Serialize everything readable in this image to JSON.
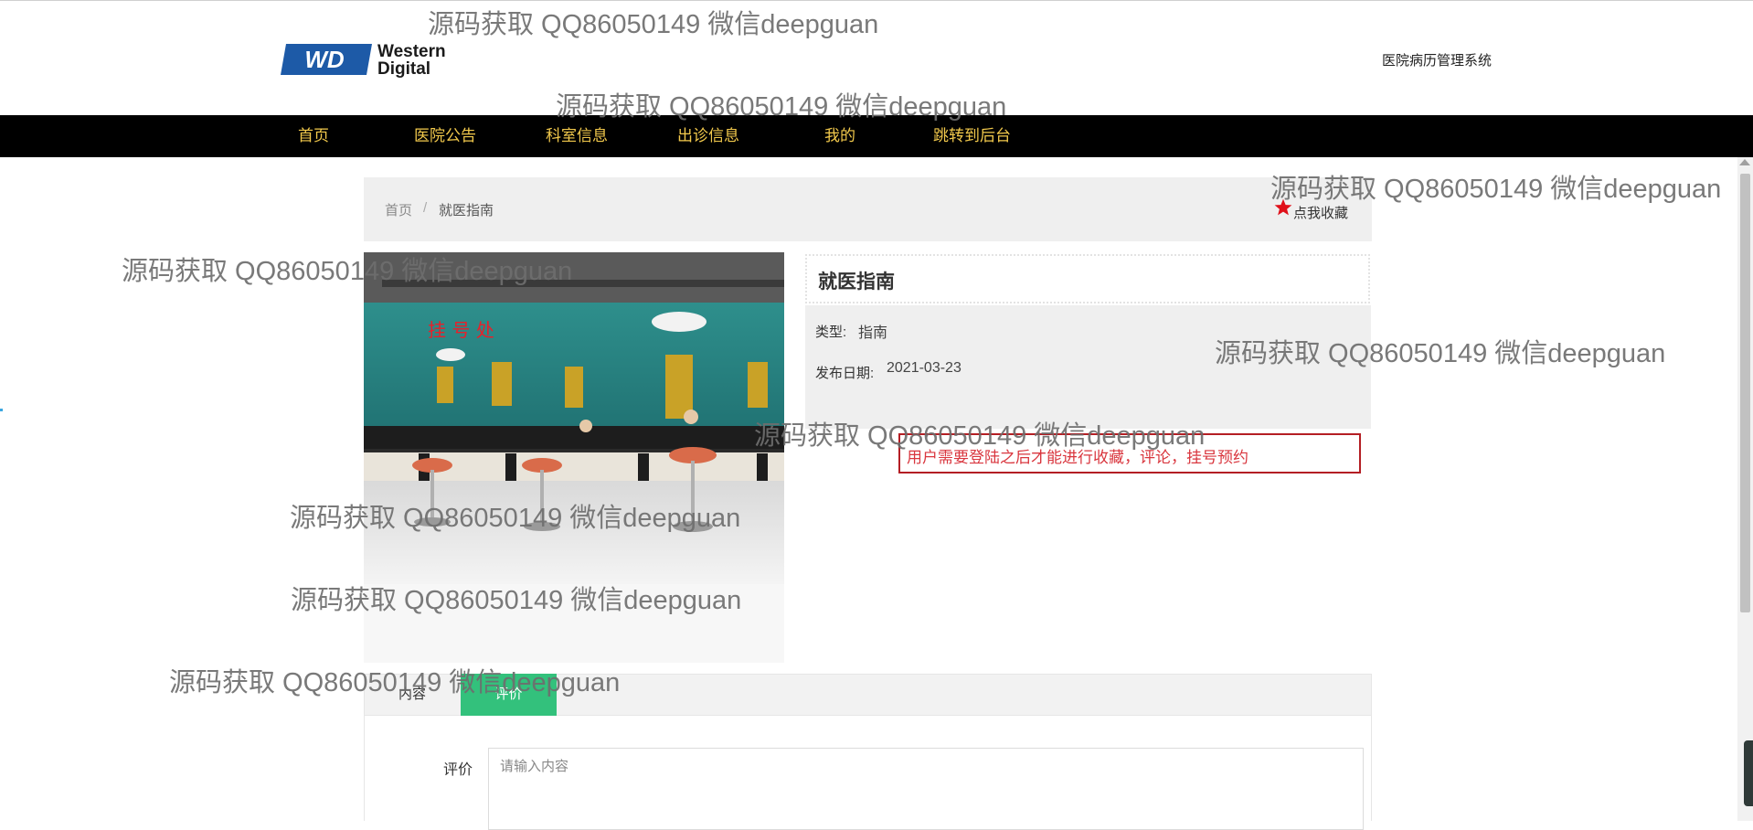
{
  "header": {
    "logo_text_line1": "Western",
    "logo_text_line2": "Digital",
    "logo_mark": "WD",
    "system_title": "医院病历管理系统"
  },
  "nav": {
    "items": [
      "首页",
      "医院公告",
      "科室信息",
      "出诊信息",
      "我的",
      "跳转到后台"
    ]
  },
  "breadcrumb": {
    "home": "首页",
    "separator": "/",
    "current": "就医指南"
  },
  "favorite": {
    "label": "点我收藏",
    "icon": "star-icon",
    "color": "#e0101a"
  },
  "detail": {
    "title": "就医指南",
    "type_label": "类型:",
    "type_value": "指南",
    "date_label": "发布日期:",
    "date_value": "2021-03-23",
    "photo_sign_text": "挂 号 处"
  },
  "alert": {
    "message": "用户需要登陆之后才能进行收藏，评论，挂号预约"
  },
  "tabs": {
    "content_label": "内容",
    "review_label": "评价",
    "active": "评价"
  },
  "review_form": {
    "label": "评价",
    "placeholder": "请输入内容",
    "value": ""
  },
  "watermark": {
    "text": "源码获取 QQ86050149 微信deepguan"
  },
  "colors": {
    "nav_bg": "#000000",
    "nav_text": "#f2c94c",
    "tab_active": "#33c17c",
    "alert_border": "#b41e24",
    "alert_text": "#d9363e"
  }
}
